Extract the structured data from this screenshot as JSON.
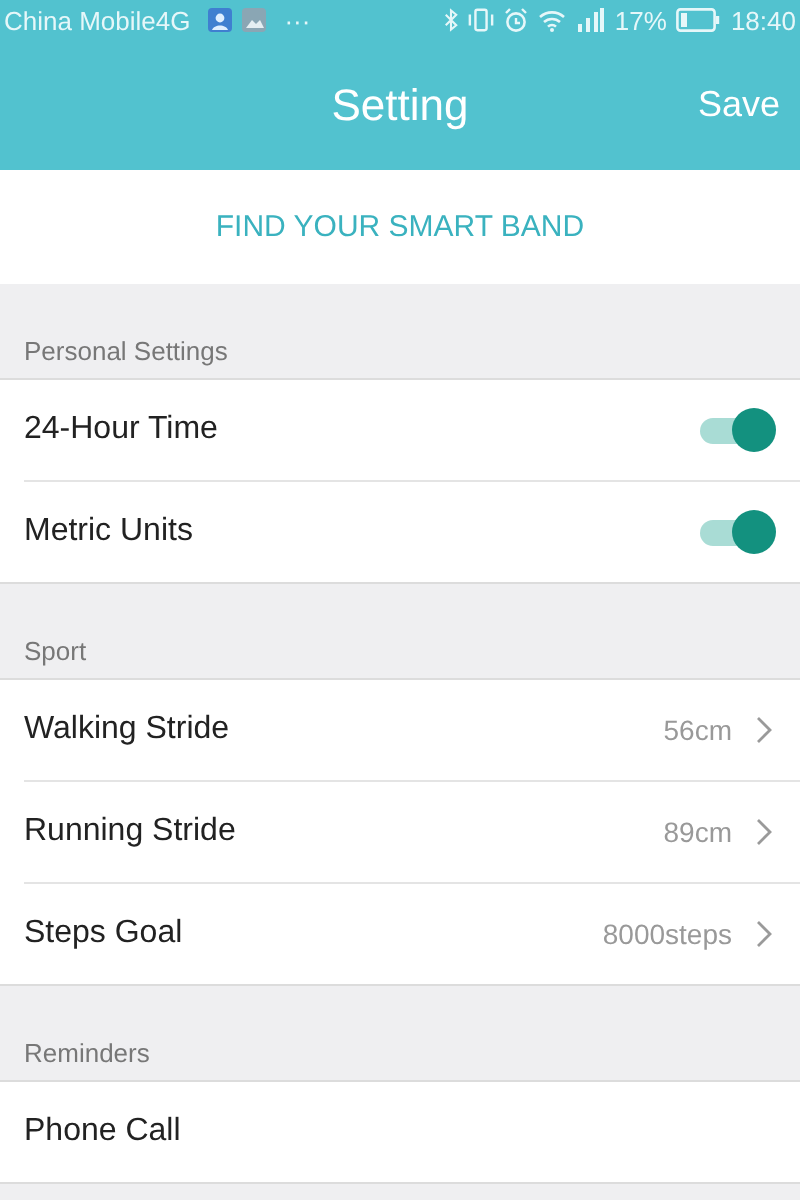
{
  "status_bar": {
    "carrier": "China Mobile4G",
    "more": "···",
    "battery": "17%",
    "time": "18:40"
  },
  "header": {
    "title": "Setting",
    "action": "Save"
  },
  "find_band": {
    "label": "FIND YOUR SMART BAND"
  },
  "sections": [
    {
      "title": "Personal Settings",
      "rows": [
        {
          "kind": "toggle",
          "label": "24-Hour Time",
          "on": true
        },
        {
          "kind": "toggle",
          "label": "Metric Units",
          "on": true
        }
      ]
    },
    {
      "title": "Sport",
      "rows": [
        {
          "kind": "value",
          "label": "Walking Stride",
          "value": "56cm"
        },
        {
          "kind": "value",
          "label": "Running Stride",
          "value": "89cm"
        },
        {
          "kind": "value",
          "label": "Steps Goal",
          "value": "8000steps"
        }
      ]
    },
    {
      "title": "Reminders",
      "rows": [
        {
          "kind": "plain",
          "label": "Phone Call"
        }
      ]
    }
  ]
}
